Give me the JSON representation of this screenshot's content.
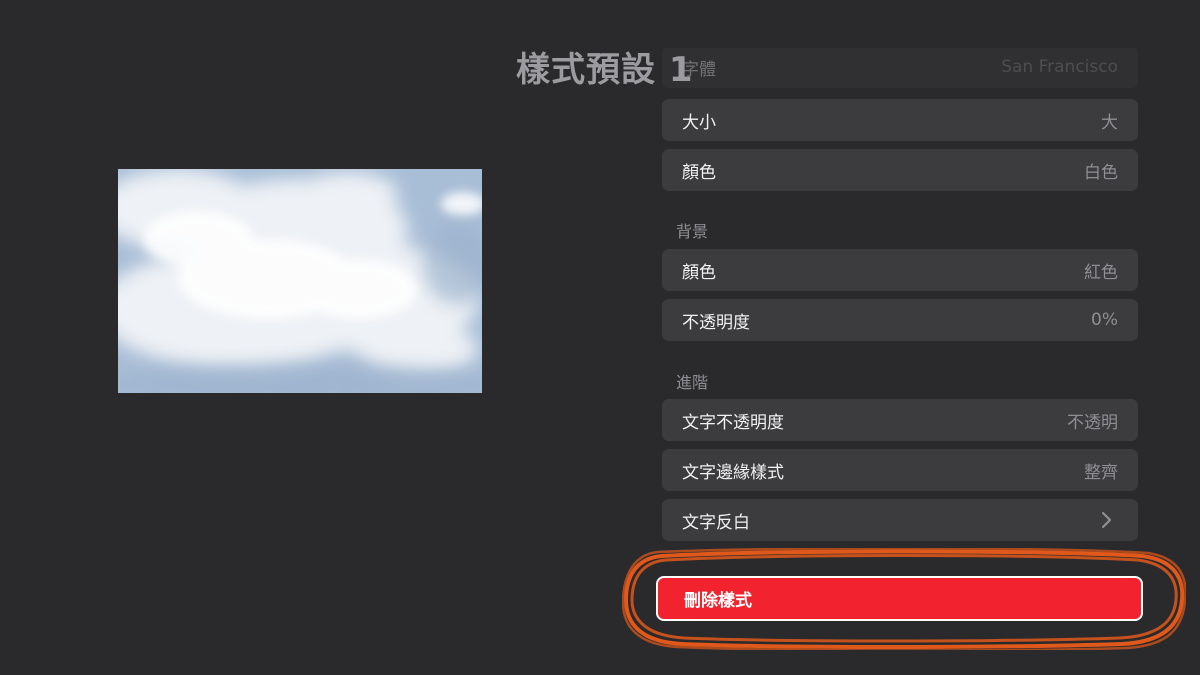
{
  "page_title": "樣式預設 1",
  "list": {
    "partial_top_row": {
      "label": "字體",
      "value": "San Francisco"
    },
    "text_rows": [
      {
        "label": "大小",
        "value": "大"
      },
      {
        "label": "顏色",
        "value": "白色"
      }
    ],
    "background_header": "背景",
    "background_rows": [
      {
        "label": "顏色",
        "value": "紅色"
      },
      {
        "label": "不透明度",
        "value": "0%"
      }
    ],
    "advanced_header": "進階",
    "advanced_rows": [
      {
        "label": "文字不透明度",
        "value": "不透明"
      },
      {
        "label": "文字邊緣樣式",
        "value": "整齊"
      },
      {
        "label": "文字反白",
        "value": ""
      }
    ]
  },
  "delete_button": {
    "label": "刪除樣式"
  },
  "colors": {
    "background": "#2a2a2c",
    "row": "#3c3c3f",
    "destructive": "#f2232e",
    "highlight_annotation": "#e0581a"
  },
  "icons": {
    "chevron": "chevron-right-icon"
  }
}
